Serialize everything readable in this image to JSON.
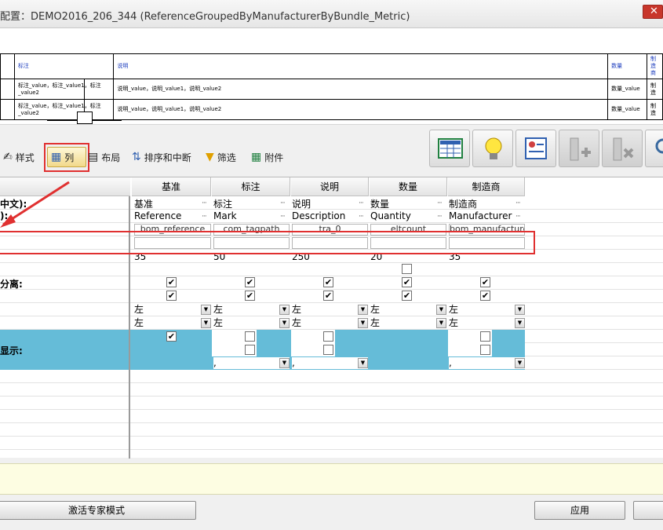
{
  "window": {
    "title": "配置：DEMO2016_206_344 (ReferenceGroupedByManufacturerByBundle_Metric)"
  },
  "preview": {
    "headers": [
      "标注",
      "说明",
      "数量",
      "制造商"
    ],
    "rows": [
      {
        "mark": "标注_value，标注_value1，标注_value2",
        "desc": "说明_value，说明_value1，说明_value2",
        "qty": "数量_value",
        "mfr": "制造"
      },
      {
        "mark": "标注_value，标注_value1，标注_value2",
        "desc": "说明_value，说明_value1，说明_value2",
        "qty": "数量_value",
        "mfr": "制造"
      }
    ]
  },
  "tabs": [
    {
      "label": "样式",
      "icon": "style-icon"
    },
    {
      "label": "列",
      "icon": "columns-icon",
      "active": true
    },
    {
      "label": "布局",
      "icon": "layout-icon"
    },
    {
      "label": "排序和中断",
      "icon": "sort-icon"
    },
    {
      "label": "筛选",
      "icon": "filter-icon"
    },
    {
      "label": "附件",
      "icon": "attachment-icon"
    }
  ],
  "toolbar_buttons": [
    "table-icon",
    "lightbulb-icon",
    "properties-icon",
    "add-column-icon",
    "delete-column-icon",
    "search-icon"
  ],
  "left_labels": {
    "row1": "中文):",
    "row2": "):",
    "separator": "分离:",
    "show": "显示:"
  },
  "columns": [
    {
      "header": "基准",
      "cn": "基准",
      "en": "Reference",
      "param": "bom_reference",
      "width": "35",
      "chk1": true,
      "chk2": true,
      "align1": "左",
      "align2": "左",
      "blue_chk": true,
      "blue_sel": ""
    },
    {
      "header": "标注",
      "cn": "标注",
      "en": "Mark",
      "param": "com_tagpath",
      "width": "50",
      "chk1": true,
      "chk2": true,
      "align1": "左",
      "align2": "左",
      "blue_chk": false,
      "blue_sel": ","
    },
    {
      "header": "说明",
      "cn": "说明",
      "en": "Description",
      "param": "tra_0",
      "width": "250",
      "chk1": true,
      "chk2": true,
      "align1": "左",
      "align2": "左",
      "blue_chk": false,
      "blue_sel": ","
    },
    {
      "header": "数量",
      "cn": "数量",
      "en": "Quantity",
      "param": "eltcount",
      "width": "20",
      "chk1": true,
      "chk2": true,
      "align1": "左",
      "align2": "左",
      "blue_chk": false,
      "blue_sel": ""
    },
    {
      "header": "制造商",
      "cn": "制造商",
      "en": "Manufacturer",
      "param": "bom_manufacturer",
      "width": "35",
      "chk1": true,
      "chk2": true,
      "align1": "左",
      "align2": "左",
      "blue_chk": false,
      "blue_sel": ","
    }
  ],
  "buttons": {
    "expert": "激活专家模式",
    "apply": "应用"
  },
  "colors": {
    "accent_blue": "#65bcd8",
    "highlight_red": "#e03030",
    "notes_yellow": "#fdfde2"
  }
}
